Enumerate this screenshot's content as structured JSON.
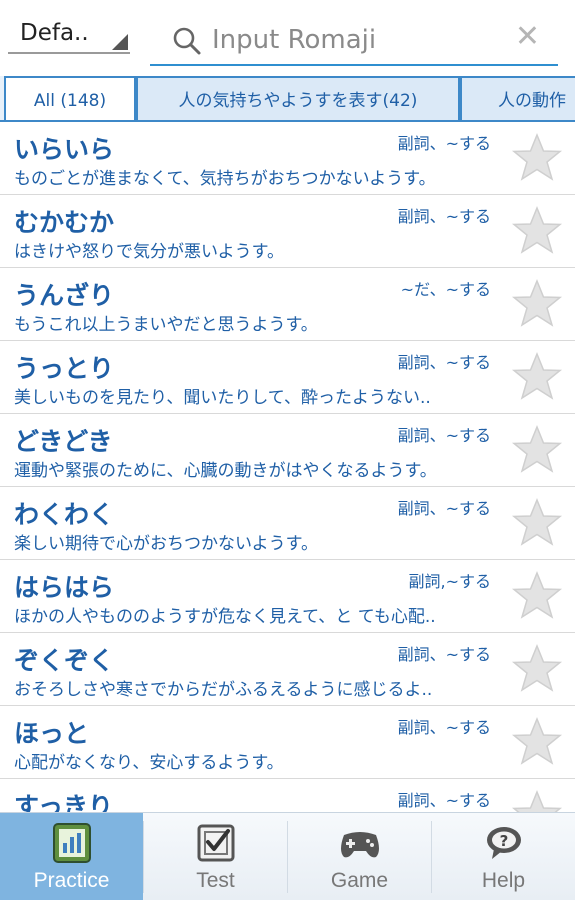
{
  "search": {
    "sort_label": "Defa..",
    "placeholder": "Input Romaji"
  },
  "tabs": [
    {
      "label": "All (148)"
    },
    {
      "label": "人の気持ちやようすを表す(42)"
    },
    {
      "label": "人の動作"
    }
  ],
  "entries": [
    {
      "word": "いらいら",
      "pos": "副詞、~する",
      "desc": "ものごとが進まなくて、気持ちがおちつかないようす。"
    },
    {
      "word": "むかむか",
      "pos": "副詞、~する",
      "desc": "はきけや怒りで気分が悪いようす。"
    },
    {
      "word": "うんざり",
      "pos": "~だ、~する",
      "desc": "もうこれ以上うまいやだと思うようす。"
    },
    {
      "word": "うっとり",
      "pos": "副詞、~する",
      "desc": "美しいものを見たり、聞いたりして、酔ったようない.."
    },
    {
      "word": "どきどき",
      "pos": "副詞、~する",
      "desc": "運動や緊張のために、心臓の動きがはやくなるようす。"
    },
    {
      "word": "わくわく",
      "pos": "副詞、~する",
      "desc": "楽しい期待で心がおちつかないようす。"
    },
    {
      "word": "はらはら",
      "pos": "副詞,~する",
      "desc": "ほかの人やもののようすが危なく見えて、と ても心配.."
    },
    {
      "word": "ぞくぞく",
      "pos": "副詞、~する",
      "desc": "おそろしさや寒さでからだがふるえるように感じるよ.."
    },
    {
      "word": "ほっと",
      "pos": "副詞、~する",
      "desc": "心配がなくなり、安心するようす。"
    },
    {
      "word": "すっきり",
      "pos": "副詞、~する",
      "desc": ""
    }
  ],
  "nav": [
    {
      "label": "Practice"
    },
    {
      "label": "Test"
    },
    {
      "label": "Game"
    },
    {
      "label": "Help"
    }
  ],
  "colors": {
    "accent": "#1f5fa6",
    "tab_border": "#3d88c8",
    "active_nav": "#7fb4e0"
  }
}
